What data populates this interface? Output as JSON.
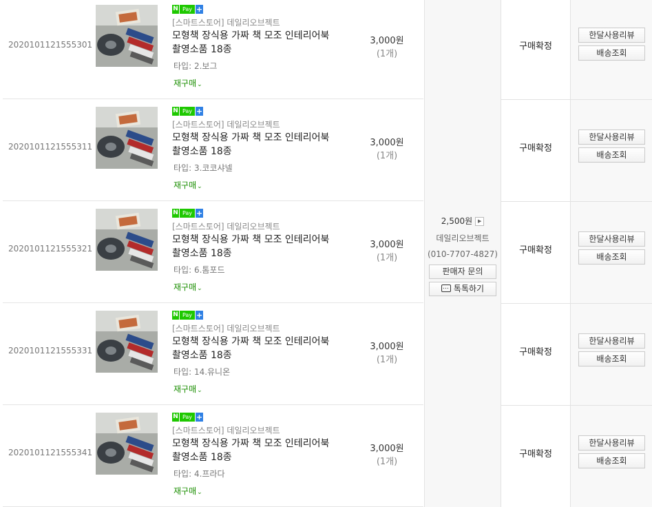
{
  "orders": [
    {
      "order_no": "2020101121555301",
      "pay_badge": {
        "n": "N",
        "pay": "Pay",
        "plus": "+"
      },
      "store": "[스마트스토어] 데일리오브젝트",
      "product_line1": "모형책 장식용 가짜 책 모조 인테리어북",
      "product_line2": "촬영소품 18종",
      "option": "타입: 2.보그",
      "rebuy": "재구매",
      "price": "3,000원",
      "qty": "(1개)",
      "status": "구매확정",
      "review_btn": "한달사용리뷰",
      "ship_btn": "배송조회"
    },
    {
      "order_no": "2020101121555311",
      "pay_badge": {
        "n": "N",
        "pay": "Pay",
        "plus": "+"
      },
      "store": "[스마트스토어] 데일리오브젝트",
      "product_line1": "모형책 장식용 가짜 책 모조 인테리어북",
      "product_line2": "촬영소품 18종",
      "option": "타입: 3.코코샤넬",
      "rebuy": "재구매",
      "price": "3,000원",
      "qty": "(1개)",
      "status": "구매확정",
      "review_btn": "한달사용리뷰",
      "ship_btn": "배송조회"
    },
    {
      "order_no": "2020101121555321",
      "pay_badge": {
        "n": "N",
        "pay": "Pay",
        "plus": "+"
      },
      "store": "[스마트스토어] 데일리오브젝트",
      "product_line1": "모형책 장식용 가짜 책 모조 인테리어북",
      "product_line2": "촬영소품 18종",
      "option": "타입: 6.톰포드",
      "rebuy": "재구매",
      "price": "3,000원",
      "qty": "(1개)",
      "status": "구매확정",
      "review_btn": "한달사용리뷰",
      "ship_btn": "배송조회"
    },
    {
      "order_no": "2020101121555331",
      "pay_badge": {
        "n": "N",
        "pay": "Pay",
        "plus": "+"
      },
      "store": "[스마트스토어] 데일리오브젝트",
      "product_line1": "모형책 장식용 가짜 책 모조 인테리어북",
      "product_line2": "촬영소품 18종",
      "option": "타입: 14.유니온",
      "rebuy": "재구매",
      "price": "3,000원",
      "qty": "(1개)",
      "status": "구매확정",
      "review_btn": "한달사용리뷰",
      "ship_btn": "배송조회"
    },
    {
      "order_no": "2020101121555341",
      "pay_badge": {
        "n": "N",
        "pay": "Pay",
        "plus": "+"
      },
      "store": "[스마트스토어] 데일리오브젝트",
      "product_line1": "모형책 장식용 가짜 책 모조 인테리어북",
      "product_line2": "촬영소품 18종",
      "option": "타입: 4.프라다",
      "rebuy": "재구매",
      "price": "3,000원",
      "qty": "(1개)",
      "status": "구매확정",
      "review_btn": "한달사용리뷰",
      "ship_btn": "배송조회"
    }
  ],
  "shipping": {
    "fee": "2,500원",
    "seller": "데일리오브젝트",
    "phone": "(010-7707-4827)",
    "inquiry_btn": "판매자 문의",
    "talk_btn": "톡톡하기"
  },
  "icons": {
    "rebuy": "chevron-down-icon",
    "fee_detail": "play-arrow-icon",
    "talk": "chat-bubble-icon"
  },
  "colors": {
    "npay_green": "#1ec800",
    "npay_plus_blue": "#2f80e4",
    "rebuy_green": "#1a8e00"
  }
}
